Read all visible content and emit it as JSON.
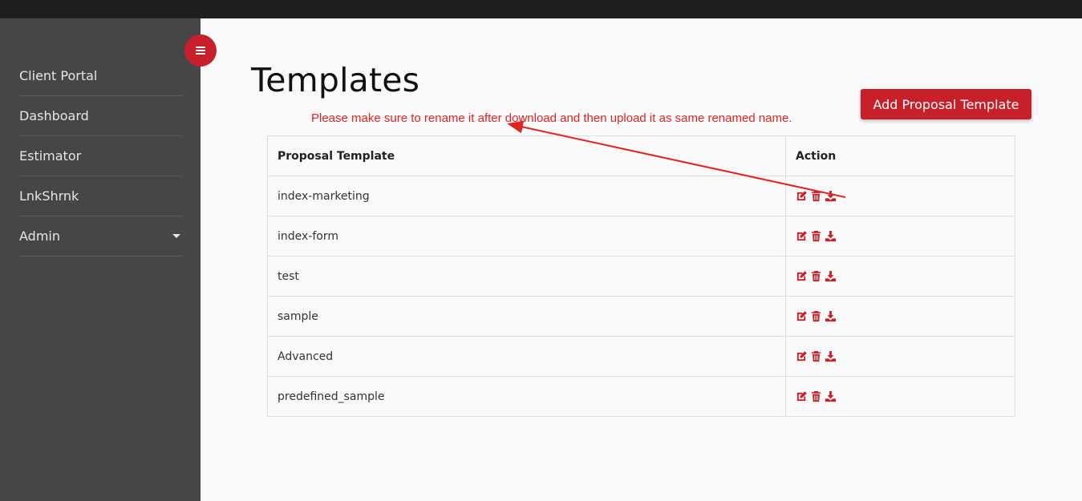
{
  "sidebar": {
    "items": [
      {
        "label": "Client Portal"
      },
      {
        "label": "Dashboard"
      },
      {
        "label": "Estimator"
      },
      {
        "label": "LnkShrnk"
      },
      {
        "label": "Admin"
      }
    ]
  },
  "main": {
    "title": "Templates",
    "notice": "Please make sure to rename it after download and then upload it as same renamed name.",
    "add_button_label": "Add Proposal Template"
  },
  "table": {
    "headers": [
      "Proposal Template",
      "Action"
    ],
    "rows": [
      {
        "name": "index-marketing"
      },
      {
        "name": "index-form"
      },
      {
        "name": "test"
      },
      {
        "name": "sample"
      },
      {
        "name": "Advanced"
      },
      {
        "name": "predefined_sample"
      }
    ],
    "action_icons": [
      "edit-icon",
      "trash-icon",
      "download-icon"
    ]
  },
  "colors": {
    "accent": "#c8202b",
    "notice_text": "#e02424",
    "sidebar_bg": "#464646",
    "topbar_bg": "#1f1f1f"
  }
}
